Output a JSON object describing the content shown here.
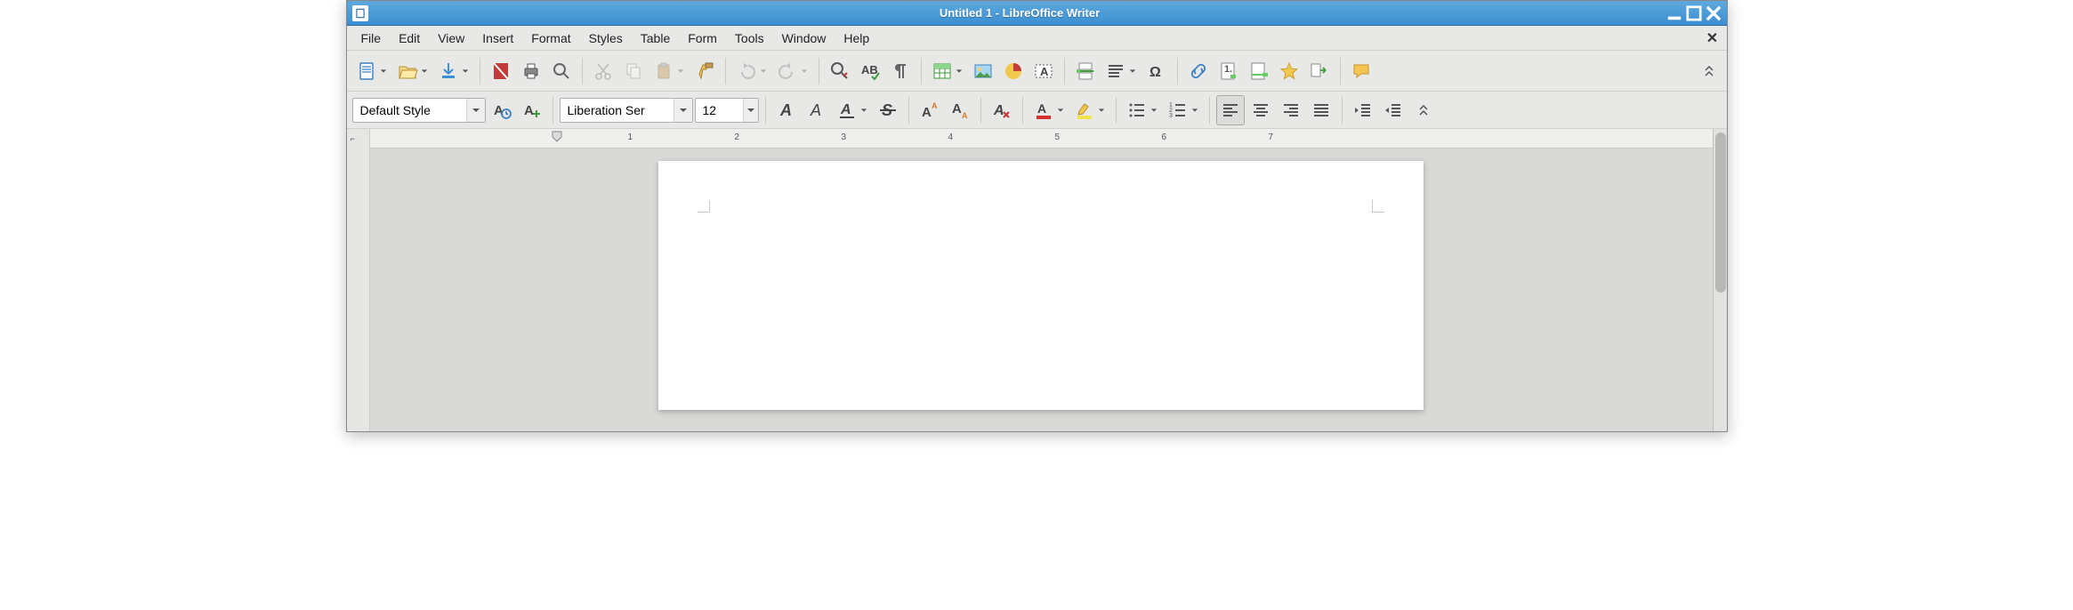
{
  "window": {
    "title": "Untitled 1 - LibreOffice Writer"
  },
  "menu": {
    "items": [
      "File",
      "Edit",
      "View",
      "Insert",
      "Format",
      "Styles",
      "Table",
      "Form",
      "Tools",
      "Window",
      "Help"
    ]
  },
  "toolbar1": {
    "new_tip": "New",
    "open_tip": "Open",
    "save_tip": "Save",
    "pdf_tip": "Export as PDF",
    "print_tip": "Print",
    "preview_tip": "Print Preview",
    "cut_tip": "Cut",
    "copy_tip": "Copy",
    "paste_tip": "Paste",
    "clone_tip": "Clone Formatting",
    "undo_tip": "Undo",
    "redo_tip": "Redo",
    "find_tip": "Find & Replace",
    "spell_tip": "Spelling",
    "para_tip": "Formatting Marks",
    "table_tip": "Table",
    "image_tip": "Image",
    "chart_tip": "Chart",
    "textbox_tip": "Text Box",
    "pagebreak_tip": "Page Break",
    "field_tip": "Field",
    "special_tip": "Special Character",
    "link_tip": "Hyperlink",
    "footnote_tip": "Footnote",
    "bookmark_tip": "Bookmark",
    "star_tip": "Favorite",
    "cross_tip": "Cross-reference",
    "comment_tip": "Comment"
  },
  "style": {
    "paragraph_style": "Default Style"
  },
  "font": {
    "name": "Liberation Ser",
    "size": "12"
  },
  "format_buttons": {
    "bold": "B",
    "italic": "I",
    "underline": "U",
    "strike": "S"
  },
  "ruler": {
    "marks": [
      "1",
      "2",
      "3",
      "4",
      "5",
      "6",
      "7"
    ]
  }
}
